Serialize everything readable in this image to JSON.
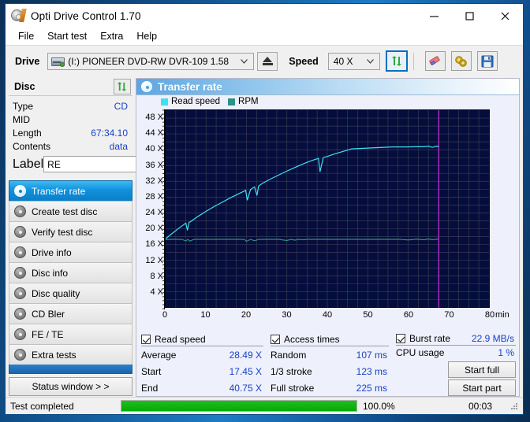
{
  "window": {
    "title": "Opti Drive Control 1.70",
    "app_icon": "disc-icon",
    "minimize": "minimize-icon",
    "maximize": "maximize-icon",
    "close": "close-icon"
  },
  "menu": {
    "items": [
      {
        "label": "File"
      },
      {
        "label": "Start test"
      },
      {
        "label": "Extra"
      },
      {
        "label": "Help"
      }
    ]
  },
  "toolbar": {
    "drive_label": "Drive",
    "drive_value": "(I:)  PIONEER DVD-RW  DVR-109 1.58",
    "eject_icon": "eject-icon",
    "speed_label": "Speed",
    "speed_value": "40 X",
    "refresh_icon": "refresh-icon",
    "erase_icon": "eraser-icon",
    "settings_icon": "gears-icon",
    "save_icon": "save-icon"
  },
  "disc": {
    "title": "Disc",
    "refresh_icon": "refresh-icon",
    "fields": [
      {
        "label": "Type",
        "value": "CD"
      },
      {
        "label": "MID",
        "value": ""
      },
      {
        "label": "Length",
        "value": "67:34.10"
      },
      {
        "label": "Contents",
        "value": "data"
      }
    ],
    "label_field_label": "Label",
    "label_field_value": "RE",
    "label_disc_icon": "disc-icon"
  },
  "nav": {
    "items": [
      {
        "label": "Transfer rate",
        "icon": "disc-icon",
        "active": true
      },
      {
        "label": "Create test disc",
        "icon": "disc-icon",
        "active": false
      },
      {
        "label": "Verify test disc",
        "icon": "disc-icon",
        "active": false
      },
      {
        "label": "Drive info",
        "icon": "disc-icon",
        "active": false
      },
      {
        "label": "Disc info",
        "icon": "disc-icon",
        "active": false
      },
      {
        "label": "Disc quality",
        "icon": "disc-icon",
        "active": false
      },
      {
        "label": "CD Bler",
        "icon": "disc-icon",
        "active": false
      },
      {
        "label": "FE / TE",
        "icon": "disc-icon",
        "active": false
      },
      {
        "label": "Extra tests",
        "icon": "disc-icon",
        "active": false
      }
    ],
    "status_window_button": "Status window > >"
  },
  "panel": {
    "title": "Transfer rate",
    "icon": "disc-icon"
  },
  "chart_data": {
    "type": "line",
    "title": "Transfer rate",
    "xlabel": "min",
    "ylabel": "X",
    "xlim": [
      0,
      80
    ],
    "ylim": [
      0,
      50
    ],
    "grid": true,
    "legend_position": "top-left",
    "x_ticks": [
      0,
      10,
      20,
      30,
      40,
      50,
      60,
      70,
      80
    ],
    "x_tick_labels": [
      "0",
      "10",
      "20",
      "30",
      "40",
      "50",
      "60",
      "70",
      "80"
    ],
    "x_unit_label": "min",
    "y_ticks": [
      4,
      8,
      12,
      16,
      20,
      24,
      28,
      32,
      36,
      40,
      44,
      48
    ],
    "y_tick_labels": [
      "4 X",
      "8 X",
      "12 X",
      "16 X",
      "20 X",
      "24 X",
      "28 X",
      "32 X",
      "36 X",
      "40 X",
      "44 X",
      "48 X"
    ],
    "plot_bg": "#050d3c",
    "grid_color": "#3a3a52",
    "marker_line": {
      "x": 67.6,
      "color": "#c82bd8",
      "label": "end-of-disc-marker"
    },
    "series": [
      {
        "name": "Read speed",
        "color": "#3ee0f0",
        "x": [
          0,
          1,
          2,
          3,
          4,
          5,
          5.4,
          5.8,
          6.2,
          7,
          8,
          10,
          12,
          14,
          16,
          18,
          19.8,
          20.2,
          21,
          22,
          22.6,
          23,
          24,
          26,
          28,
          30,
          32,
          34,
          36,
          37.8,
          38.2,
          39,
          40,
          42,
          44,
          46,
          48,
          50,
          52,
          54,
          56,
          58,
          60,
          62,
          64,
          65,
          66,
          67,
          67.6
        ],
        "y": [
          17.45,
          18.3,
          19.1,
          19.9,
          20.65,
          21.4,
          19.6,
          21.6,
          21.8,
          22.4,
          23.1,
          24.4,
          25.6,
          26.7,
          27.8,
          28.8,
          29.7,
          27.2,
          29.9,
          30.6,
          28.4,
          30.8,
          31.5,
          32.6,
          33.6,
          34.6,
          35.5,
          36.4,
          37.2,
          37.8,
          34.4,
          38.0,
          38.3,
          39.0,
          39.6,
          40.2,
          40.3,
          40.4,
          40.5,
          40.6,
          40.7,
          40.7,
          40.7,
          40.75,
          40.75,
          40.9,
          40.6,
          40.9,
          40.75
        ]
      },
      {
        "name": "RPM",
        "color": "#2f8f8a",
        "x": [
          0,
          2,
          4,
          5,
          5.5,
          6,
          7,
          8,
          10,
          14,
          18,
          19.5,
          20,
          21,
          22,
          23,
          28,
          30,
          31,
          32,
          33,
          34,
          35,
          36,
          38,
          40,
          45,
          50,
          55,
          58,
          60,
          62,
          64,
          65,
          66,
          67,
          67.6
        ],
        "y": [
          17.25,
          17.3,
          17.3,
          16.9,
          17.3,
          16.85,
          17.3,
          17.3,
          17.3,
          17.3,
          17.3,
          17.3,
          16.8,
          17.3,
          16.95,
          17.3,
          17.3,
          17.0,
          17.3,
          17.1,
          17.3,
          17.2,
          17.3,
          17.3,
          17.3,
          17.3,
          17.3,
          17.3,
          17.3,
          17.3,
          17.15,
          17.35,
          17.2,
          17.4,
          17.2,
          17.35,
          17.3
        ]
      }
    ]
  },
  "results": {
    "read_speed": {
      "header": "Read speed",
      "checked": true,
      "rows": [
        {
          "label": "Average",
          "value": "28.49 X"
        },
        {
          "label": "Start",
          "value": "17.45 X"
        },
        {
          "label": "End",
          "value": "40.75 X"
        }
      ]
    },
    "access_times": {
      "header": "Access times",
      "checked": true,
      "rows": [
        {
          "label": "Random",
          "value": "107 ms"
        },
        {
          "label": "1/3 stroke",
          "value": "123 ms"
        },
        {
          "label": "Full stroke",
          "value": "225 ms"
        }
      ]
    },
    "burst": {
      "header": "Burst rate",
      "checked": true,
      "header_value": "22.9 MB/s",
      "rows": [
        {
          "label": "CPU usage",
          "value": "1 %"
        }
      ],
      "start_full_button": "Start full",
      "start_part_button": "Start part"
    }
  },
  "statusbar": {
    "status": "Test completed",
    "progress_percent": 100.0,
    "progress_label": "100.0%",
    "elapsed": "00:03"
  }
}
